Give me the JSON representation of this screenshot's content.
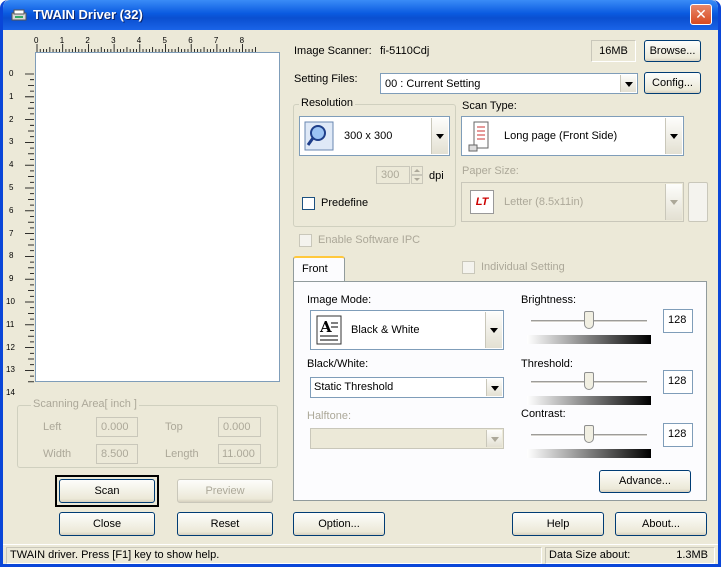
{
  "window": {
    "title": "TWAIN Driver (32)"
  },
  "ruler": {
    "h_ticks": [
      "0",
      "1",
      "2",
      "3",
      "4",
      "5",
      "6",
      "7",
      "8"
    ],
    "v_ticks": [
      "0",
      "1",
      "2",
      "3",
      "4",
      "5",
      "6",
      "7",
      "8",
      "9",
      "10",
      "11",
      "12",
      "13",
      "14"
    ]
  },
  "scanning_area": {
    "label": "Scanning Area[ inch ]",
    "left_label": "Left",
    "left_value": "0.000",
    "top_label": "Top",
    "top_value": "0.000",
    "width_label": "Width",
    "width_value": "8.500",
    "length_label": "Length",
    "length_value": "11.000"
  },
  "buttons": {
    "scan": "Scan",
    "preview": "Preview",
    "close": "Close",
    "reset": "Reset",
    "browse": "Browse...",
    "config": "Config...",
    "option": "Option...",
    "help": "Help",
    "about": "About...",
    "advance": "Advance..."
  },
  "scanner": {
    "label": "Image Scanner:",
    "name": "fi-5110Cdj",
    "memory": "16MB"
  },
  "setting_files": {
    "label": "Setting Files:",
    "value": "00 : Current Setting"
  },
  "resolution": {
    "label": "Resolution",
    "value": "300 x 300",
    "custom_value": "300",
    "unit": "dpi",
    "predefine_label": "Predefine"
  },
  "scan_type": {
    "label": "Scan Type:",
    "value": "Long page (Front Side)"
  },
  "paper_size": {
    "label": "Paper Size:",
    "badge": "LT",
    "value": "Letter (8.5x11in)"
  },
  "enable_software_ipc": "Enable Software IPC",
  "tabs": {
    "front": "Front",
    "individual_setting": "Individual Setting"
  },
  "image_mode": {
    "label": "Image Mode:",
    "value": "Black & White"
  },
  "black_white": {
    "label": "Black/White:",
    "value": "Static Threshold"
  },
  "halftone": {
    "label": "Halftone:",
    "value": ""
  },
  "brightness": {
    "label": "Brightness:",
    "value": "128",
    "level": 0.5
  },
  "threshold": {
    "label": "Threshold:",
    "value": "128",
    "level": 0.5
  },
  "contrast": {
    "label": "Contrast:",
    "value": "128",
    "level": 0.5
  },
  "status": {
    "help": "TWAIN driver. Press [F1] key to show help.",
    "data_size_label": "Data Size about:",
    "data_size_value": "1.3MB"
  }
}
